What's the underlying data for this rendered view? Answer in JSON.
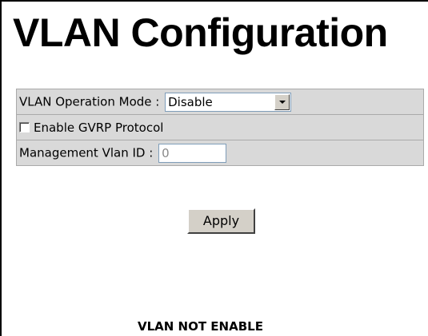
{
  "page": {
    "title": "VLAN Configuration",
    "status_message": "VLAN NOT ENABLE"
  },
  "form": {
    "operation_mode": {
      "label": "VLAN Operation Mode :",
      "selected": "Disable",
      "options": [
        "Disable"
      ]
    },
    "gvrp": {
      "label": "Enable GVRP Protocol",
      "checked": false
    },
    "management_vlan": {
      "label": "Management Vlan ID :",
      "value": "0"
    },
    "apply_label": "Apply"
  },
  "colors": {
    "row_background": "#d9d9d9",
    "button_face": "#d4d0c8",
    "input_border": "#7f9db9",
    "disabled_text": "#8a8a8a"
  }
}
